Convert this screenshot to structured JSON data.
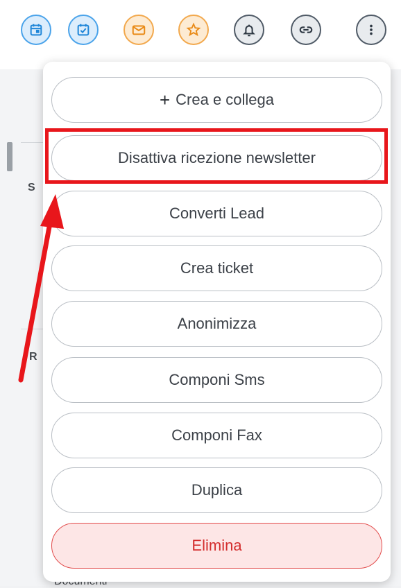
{
  "toolbar": {
    "buttons": [
      {
        "name": "calendar-icon",
        "variant": "blue"
      },
      {
        "name": "task-check-icon",
        "variant": "blue"
      },
      {
        "name": "mail-icon",
        "variant": "orange"
      },
      {
        "name": "star-icon",
        "variant": "orange"
      },
      {
        "name": "bell-icon",
        "variant": "gray"
      },
      {
        "name": "link-icon",
        "variant": "gray"
      },
      {
        "name": "more-vertical-icon",
        "variant": "gray"
      }
    ]
  },
  "background": {
    "partial_label_1": "S",
    "partial_label_2": "R",
    "partial_bottom_text": "Documenti"
  },
  "menu": {
    "items": [
      {
        "label": "Crea e collega",
        "icon": "plus-icon"
      },
      {
        "label": "Disattiva ricezione newsletter"
      },
      {
        "label": "Converti Lead"
      },
      {
        "label": "Crea ticket"
      },
      {
        "label": "Anonimizza"
      },
      {
        "label": "Componi Sms"
      },
      {
        "label": "Componi Fax"
      },
      {
        "label": "Duplica"
      },
      {
        "label": "Elimina",
        "style": "danger"
      }
    ]
  },
  "annotations": {
    "highlight_color": "#e8161b",
    "arrow_color": "#e8161b"
  },
  "colors": {
    "blue_accent": "#4aa3ea",
    "orange_accent": "#f2a84c",
    "danger": "#e24b4b"
  }
}
